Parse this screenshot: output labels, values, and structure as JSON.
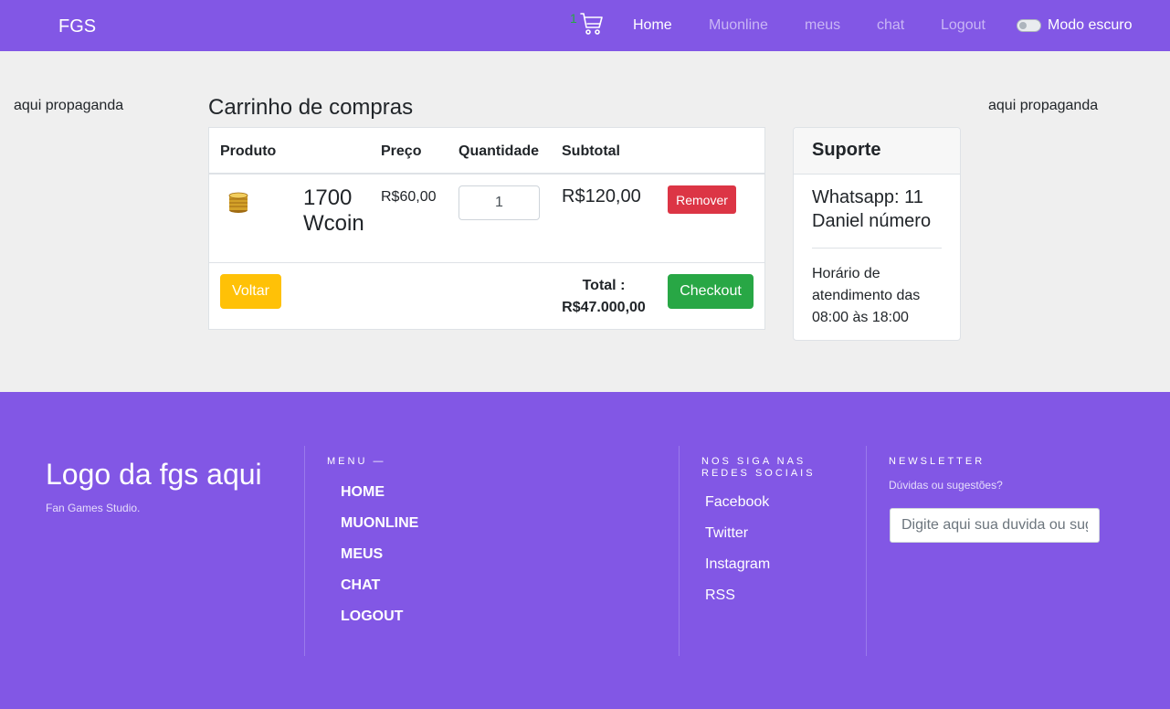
{
  "nav": {
    "brand": "FGS",
    "cart_count": "1",
    "links": [
      "Home",
      "Muonline",
      "meus",
      "chat",
      "Logout"
    ],
    "dark_mode_label": "Modo escuro"
  },
  "ads": {
    "left": "aqui propaganda",
    "right": "aqui propaganda"
  },
  "cart": {
    "title": "Carrinho de compras",
    "headers": [
      "Produto",
      "Preço",
      "Quantidade",
      "Subtotal"
    ],
    "item": {
      "name": "1700 Wcoin",
      "price": "R$60,00",
      "quantity": "1",
      "subtotal": "R$120,00",
      "remove_label": "Remover"
    },
    "back_label": "Voltar",
    "total_label": "Total :",
    "total_value": "R$47.000,00",
    "checkout_label": "Checkout"
  },
  "support": {
    "title": "Suporte",
    "whatsapp": "Whatsapp: 11 Daniel número",
    "hours": "Horário de atendimento das 08:00 às 18:00"
  },
  "footer": {
    "logo": "Logo da fgs aqui",
    "tagline": "Fan Games Studio.",
    "menu_heading": "MENU —",
    "menu_items": [
      "HOME",
      "MUONLINE",
      "MEUS",
      "CHAT",
      "LOGOUT"
    ],
    "social_heading": "NOS SIGA NAS REDES SOCIAIS",
    "social_items": [
      "Facebook",
      "Twitter",
      "Instagram",
      "RSS"
    ],
    "newsletter_heading": "NEWSLETTER",
    "newsletter_sub": "Dúvidas ou sugestões?",
    "newsletter_placeholder": "Digite aqui sua duvida ou sugestão"
  },
  "colors": {
    "primary": "#8257e5",
    "danger": "#dc3545",
    "warning": "#ffc107",
    "success": "#28a745"
  }
}
